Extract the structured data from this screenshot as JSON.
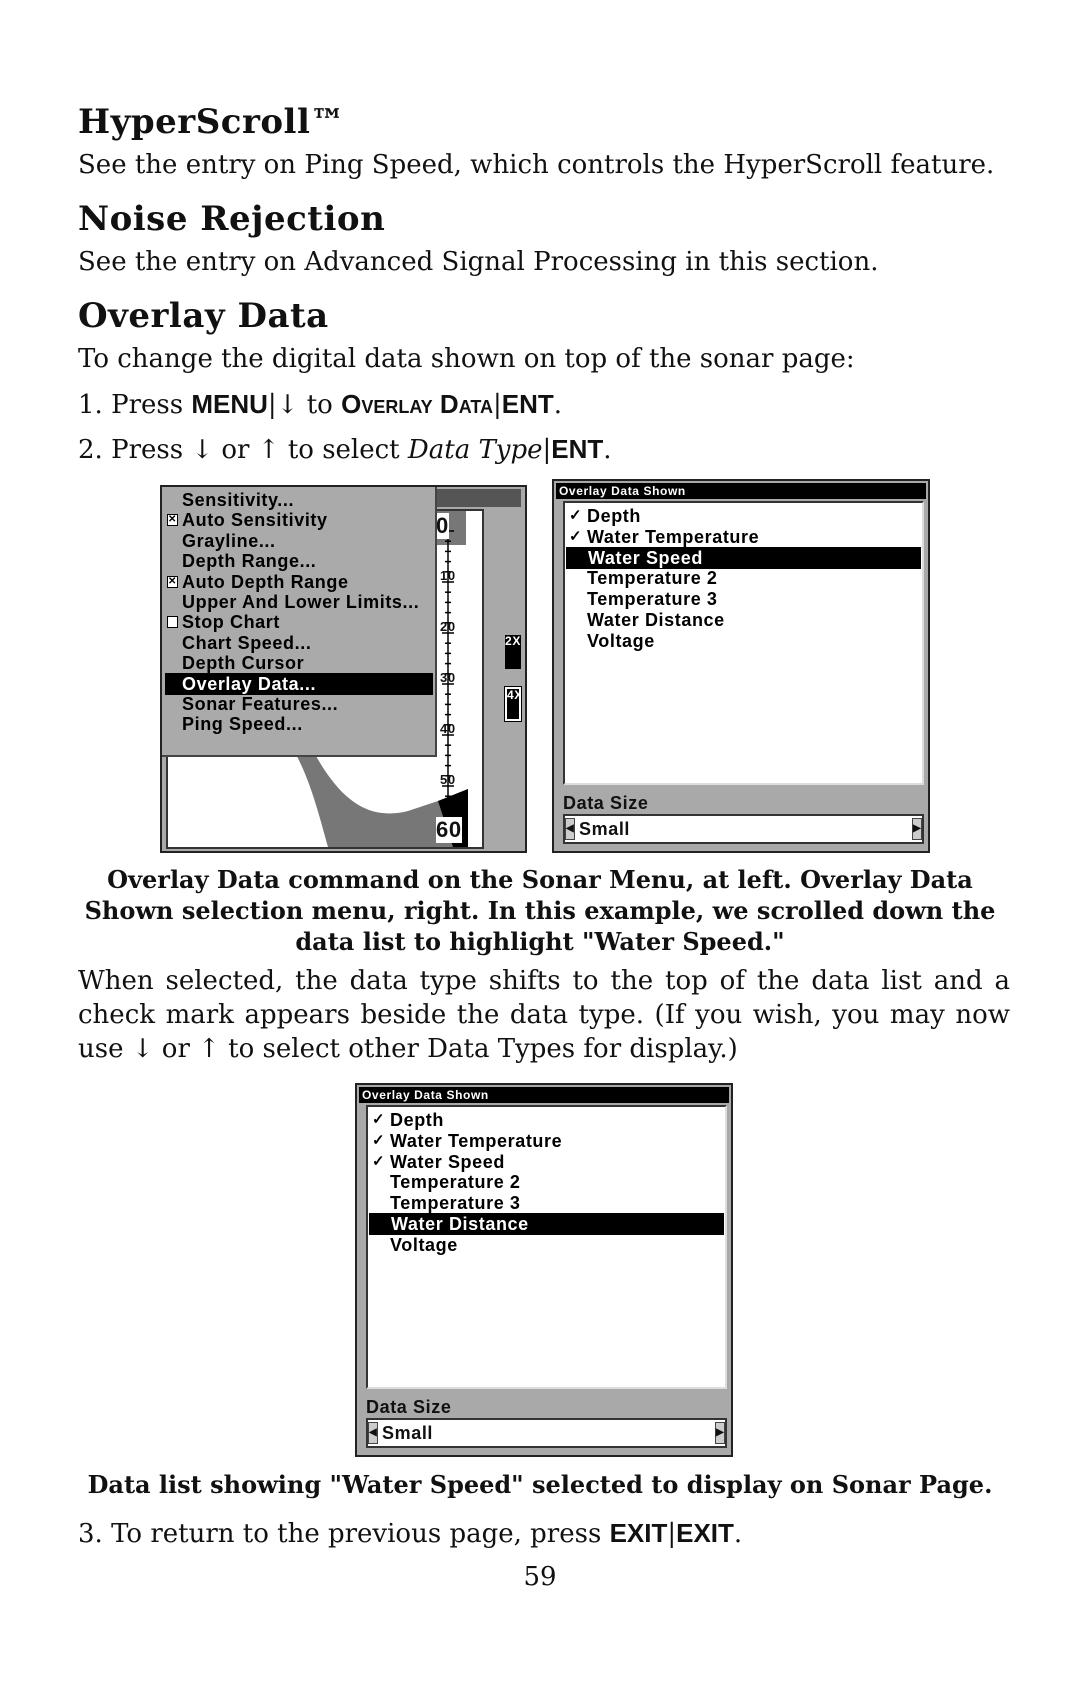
{
  "sections": [
    {
      "heading": "HyperScroll™",
      "text": "See the entry on Ping Speed, which controls the HyperScroll feature."
    },
    {
      "heading": "Noise Rejection",
      "text": "See the entry on Advanced Signal Processing in this section."
    },
    {
      "heading": "Overlay Data",
      "text": "To change the digital data shown on top of the sonar page:"
    }
  ],
  "steps": {
    "s1": {
      "num": "1. Press ",
      "menu": "MENU",
      "sep": "|",
      "arrow": "↓",
      "to": " to ",
      "target": "Overlay Data",
      "ent": "ENT",
      "end": "."
    },
    "s2": {
      "num": "2. Press ",
      "down": "↓",
      "or": " or ",
      "up": "↑",
      "to": " to select ",
      "target": "Data Type",
      "ent": "ENT",
      "end": "."
    },
    "s3": {
      "text": "3. To return to the previous page, press ",
      "k1": "EXIT",
      "sep": "|",
      "k2": "EXIT",
      "end": "."
    }
  },
  "sonar_menu": {
    "items": [
      {
        "label": "Sensitivity...",
        "checkbox": null
      },
      {
        "label": "Auto Sensitivity",
        "checkbox": "checked"
      },
      {
        "label": "Grayline...",
        "checkbox": null
      },
      {
        "label": "Depth Range...",
        "checkbox": null
      },
      {
        "label": "Auto Depth Range",
        "checkbox": "checked"
      },
      {
        "label": "Upper And Lower Limits...",
        "checkbox": null
      },
      {
        "label": "Stop Chart",
        "checkbox": "unchecked"
      },
      {
        "label": "Chart Speed...",
        "checkbox": null
      },
      {
        "label": "Depth Cursor",
        "checkbox": null
      },
      {
        "label": "Overlay Data...",
        "checkbox": null,
        "selected": true
      },
      {
        "label": "Sonar Features...",
        "checkbox": null
      },
      {
        "label": "Ping Speed...",
        "checkbox": null
      }
    ],
    "depth_scale": [
      "0",
      "10",
      "20",
      "30",
      "40",
      "50",
      "60"
    ],
    "zoom_labels": [
      "2X",
      "4X"
    ]
  },
  "dialog1": {
    "title": "Overlay Data Shown",
    "items": [
      {
        "label": "Depth",
        "checked": true
      },
      {
        "label": "Water Temperature",
        "checked": true
      },
      {
        "label": "Water Speed",
        "checked": false,
        "selected": true
      },
      {
        "label": "Temperature 2",
        "checked": false
      },
      {
        "label": "Temperature 3",
        "checked": false
      },
      {
        "label": "Water Distance",
        "checked": false
      },
      {
        "label": "Voltage",
        "checked": false
      }
    ],
    "data_size_label": "Data Size",
    "data_size_value": "Small"
  },
  "caption1": [
    "Overlay Data command on the Sonar Menu, at left. Overlay Data",
    "Shown selection menu, right. In this example, we scrolled down the",
    "data list to highlight \"Water Speed.\""
  ],
  "paragraph": [
    "When selected, the data type shifts to the top of the data list and a",
    "check mark appears beside the data type. (If you wish, you may now",
    "use ↓ or ↑ to select other Data Types for display.)"
  ],
  "dialog2": {
    "title": "Overlay Data Shown",
    "items": [
      {
        "label": "Depth",
        "checked": true
      },
      {
        "label": "Water Temperature",
        "checked": true
      },
      {
        "label": "Water Speed",
        "checked": true
      },
      {
        "label": "Temperature 2",
        "checked": false
      },
      {
        "label": "Temperature 3",
        "checked": false
      },
      {
        "label": "Water Distance",
        "checked": false,
        "selected": true
      },
      {
        "label": "Voltage",
        "checked": false
      }
    ],
    "data_size_label": "Data Size",
    "data_size_value": "Small"
  },
  "caption2": "Data list showing \"Water Speed\" selected to display on Sonar Page.",
  "page_number": "59"
}
